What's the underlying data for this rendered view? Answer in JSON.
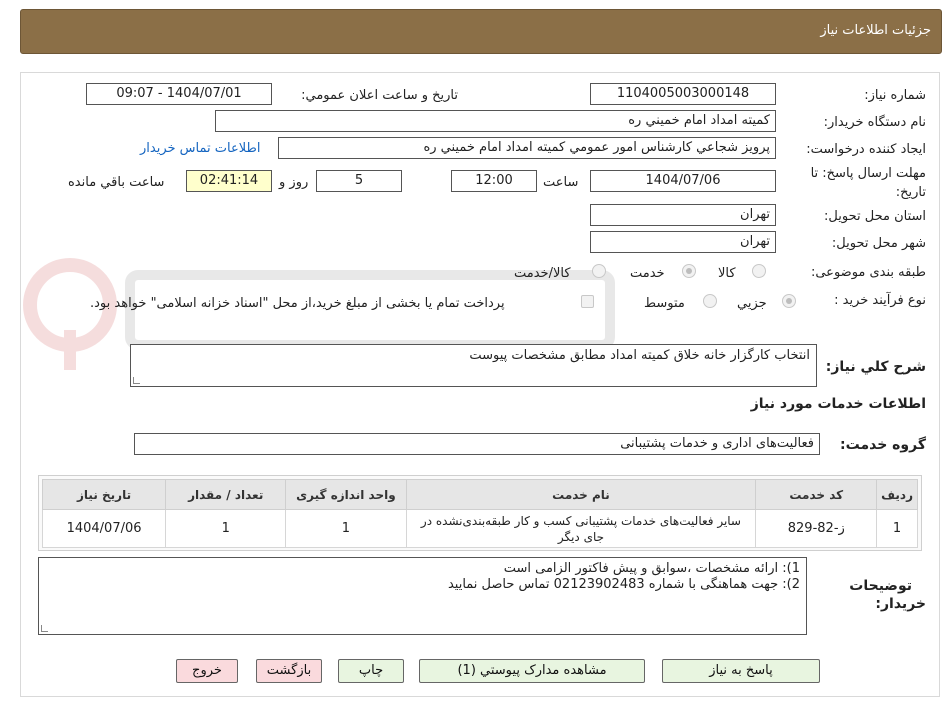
{
  "header": {
    "title": "جزئيات اطلاعات نياز"
  },
  "fields": {
    "need_number_label": "شماره نياز:",
    "need_number": "1104005003000148",
    "announce_label": "تاريخ و ساعت اعلان عمومي:",
    "announce_value": "1404/07/01 - 09:07",
    "buyer_org_label": "نام دستگاه خريدار:",
    "buyer_org": "کميته امداد امام خميني ره",
    "requester_label": "ايجاد کننده درخواست:",
    "requester": "پرويز شجاعي کارشناس امور عمومي کميته امداد امام خميني ره",
    "contact_link": "اطلاعات تماس خريدار",
    "deadline_label_1": "مهلت ارسال پاسخ: تا",
    "deadline_label_2": "تاريخ:",
    "deadline_date": "1404/07/06",
    "time_label": "ساعت",
    "deadline_time": "12:00",
    "days_value": "5",
    "days_label": "روز و",
    "remaining_time": "02:41:14",
    "remaining_label": "ساعت باقي مانده",
    "province_label": "استان محل تحويل:",
    "province": "تهران",
    "city_label": "شهر محل تحويل:",
    "city": "تهران",
    "category_label": "طبقه بندی موضوعی:",
    "category_options": [
      "کالا",
      "خدمت",
      "کالا/خدمت"
    ],
    "process_label": "نوع فرآيند خريد :",
    "process_options": [
      "جزيي",
      "متوسط"
    ],
    "payment_note": "پرداخت تمام يا بخشی از مبلغ خريد،از محل \"اسناد خزانه اسلامی\" خواهد بود."
  },
  "description": {
    "label": "شرح کلي نياز:",
    "value": "انتخاب کارگزار خانه خلاق کميته امداد مطابق مشخصات پيوست"
  },
  "services": {
    "section_title": "اطلاعات خدمات مورد نياز",
    "group_label": "گروه خدمت:",
    "group_value": "فعاليت‌هاى ادارى و خدمات پشتيبانى",
    "columns": [
      "رديف",
      "کد خدمت",
      "نام خدمت",
      "واحد اندازه گيری",
      "تعداد / مقدار",
      "تاريخ نياز"
    ],
    "rows": [
      [
        "1",
        "ز-82-829",
        "ساير فعاليت‌هاى خدمات پشتيبانى کسب و کار طبقه‌بندى‌نشده در جاى ديگر",
        "1",
        "1",
        "1404/07/06"
      ]
    ]
  },
  "buyer_notes": {
    "label_1": "توضيحات",
    "label_2": "خريدار:",
    "lines": [
      "1): ارائه مشخصات ،سوابق و پيش فاکتور الزامی است",
      "2): جهت هماهنگی با شماره 02123902483 تماس حاصل نماييد"
    ]
  },
  "buttons": {
    "reply": "پاسخ به نياز",
    "attachments": "مشاهده مدارک پيوستي (1)",
    "print": "چاپ",
    "back": "بازگشت",
    "exit": "خروج"
  },
  "colors": {
    "header_bg": "#8b6f47",
    "button_green": "#e8f5e0",
    "button_pink": "#fadadd",
    "timer_bg": "#ffffcc"
  }
}
